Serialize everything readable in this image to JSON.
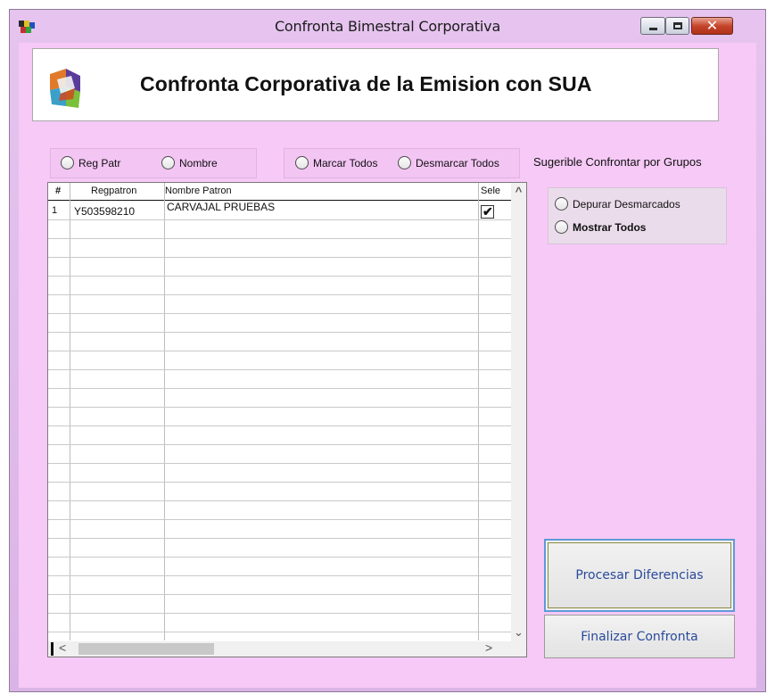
{
  "window": {
    "title": "Confronta Bimestral Corporativa",
    "controls": {
      "minimize": "minimize-icon",
      "maximize": "maximize-icon",
      "close": "close-icon",
      "close_glyph": "✕"
    }
  },
  "banner": {
    "title": "Confronta Corporativa de la Emision con SUA",
    "logo": "app-logo-icon"
  },
  "sort_options": [
    {
      "label": "Reg Patr"
    },
    {
      "label": "Nombre"
    }
  ],
  "mark_options": [
    {
      "label": "Marcar Todos"
    },
    {
      "label": "Desmarcar Todos"
    }
  ],
  "group_hint": "Sugerible Confrontar por Grupos",
  "filter_options": [
    {
      "label": "Depurar Desmarcados"
    },
    {
      "label": "Mostrar Todos"
    }
  ],
  "grid": {
    "columns": [
      "#",
      "Regpatron",
      "Nombre Patron",
      "Sele"
    ],
    "rows": [
      {
        "num": "1",
        "regpatron": "Y503598210",
        "nombre": "CARVAJAL PRUEBAS",
        "selected": true
      }
    ],
    "check_glyph": "✔",
    "scroll": {
      "up": "^",
      "down": "⌄",
      "left": "<",
      "right": ">"
    }
  },
  "buttons": {
    "procesar": "Procesar Diferencias",
    "finalizar": "Finalizar Confronta"
  },
  "colors": {
    "client_background": "#f6c9f6",
    "button_text": "#2a4a9a"
  }
}
